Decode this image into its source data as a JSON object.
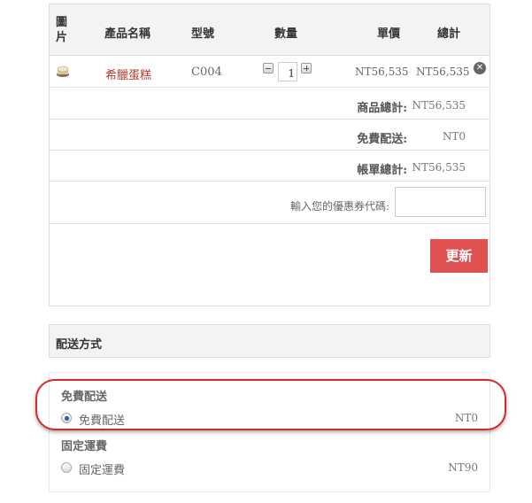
{
  "cart": {
    "headers": {
      "image": "圖\n片",
      "name": "產品名稱",
      "model": "型號",
      "quantity": "數量",
      "unit_price": "單價",
      "total": "總計"
    },
    "items": [
      {
        "name": "希臘蛋糕",
        "model": "C004",
        "quantity": "1",
        "unit_price": "NT56,535",
        "total": "NT56,535",
        "image_icon": "cake-icon",
        "remove_icon": "remove-icon"
      }
    ],
    "summary": [
      {
        "label": "商品總計:",
        "value": "NT56,535"
      },
      {
        "label": "免費配送:",
        "value": "NT0"
      },
      {
        "label": "帳單總計:",
        "value": "NT56,535"
      }
    ],
    "coupon_label": "輸入您的優惠券代碼:",
    "coupon_value": "",
    "update_label": "更新"
  },
  "shipping": {
    "title": "配送方式",
    "groups": [
      {
        "title": "免費配送",
        "option": "免費配送",
        "price": "NT0",
        "selected": true
      },
      {
        "title": "固定運費",
        "option": "固定運費",
        "price": "NT90",
        "selected": false
      }
    ]
  },
  "colors": {
    "accent": "#e05151",
    "product_link": "#b03a2e",
    "highlight": "#d12a2a",
    "radio_selected": "#2a5db0"
  }
}
